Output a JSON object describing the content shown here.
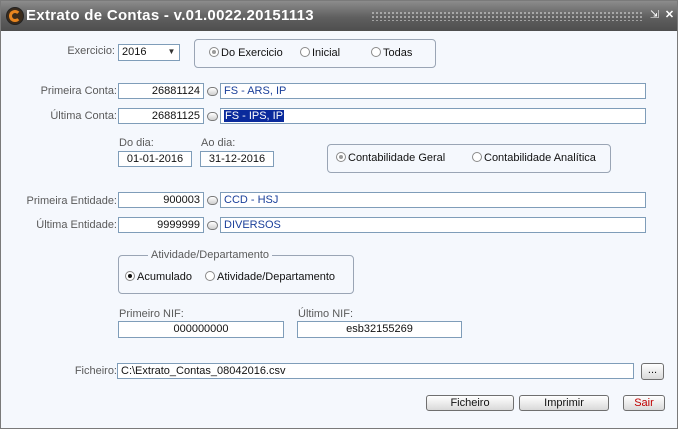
{
  "window": {
    "title": "Extrato de Contas - v.01.0022.20151113"
  },
  "exercicio": {
    "label": "Exercicio:",
    "value": "2016"
  },
  "scope": {
    "options": [
      {
        "label": "Do Exercicio",
        "selected": true
      },
      {
        "label": "Inicial",
        "selected": false
      },
      {
        "label": "Todas",
        "selected": false
      }
    ]
  },
  "primeira_conta": {
    "label": "Primeira Conta:",
    "code": "26881124",
    "name": "FS - ARS, IP"
  },
  "ultima_conta": {
    "label": "Última Conta:",
    "code": "26881125",
    "name": "FS - IPS, IP"
  },
  "dates": {
    "from_label": "Do dia:",
    "from_value": "01-01-2016",
    "to_label": "Ao dia:",
    "to_value": "31-12-2016"
  },
  "contabilidade": {
    "options": [
      {
        "label": "Contabilidade Geral",
        "selected": true
      },
      {
        "label": "Contabilidade Analítica",
        "selected": false
      }
    ]
  },
  "primeira_entidade": {
    "label": "Primeira Entidade:",
    "code": "900003",
    "name": "CCD - HSJ"
  },
  "ultima_entidade": {
    "label": "Última Entidade:",
    "code": "9999999",
    "name": "DIVERSOS"
  },
  "atividade": {
    "legend": "Atividade/Departamento",
    "options": [
      {
        "label": "Acumulado",
        "selected": true
      },
      {
        "label": "Atividade/Departamento",
        "selected": false
      }
    ]
  },
  "nif": {
    "first_label": "Primeiro NIF:",
    "first_value": "000000000",
    "last_label": "Último NIF:",
    "last_value": "esb32155269"
  },
  "ficheiro": {
    "label": "Ficheiro:",
    "value": "C:\\Extrato_Contas_08042016.csv",
    "browse_label": "..."
  },
  "buttons": {
    "ficheiro": "Ficheiro",
    "imprimir": "Imprimir",
    "sair": "Sair"
  }
}
